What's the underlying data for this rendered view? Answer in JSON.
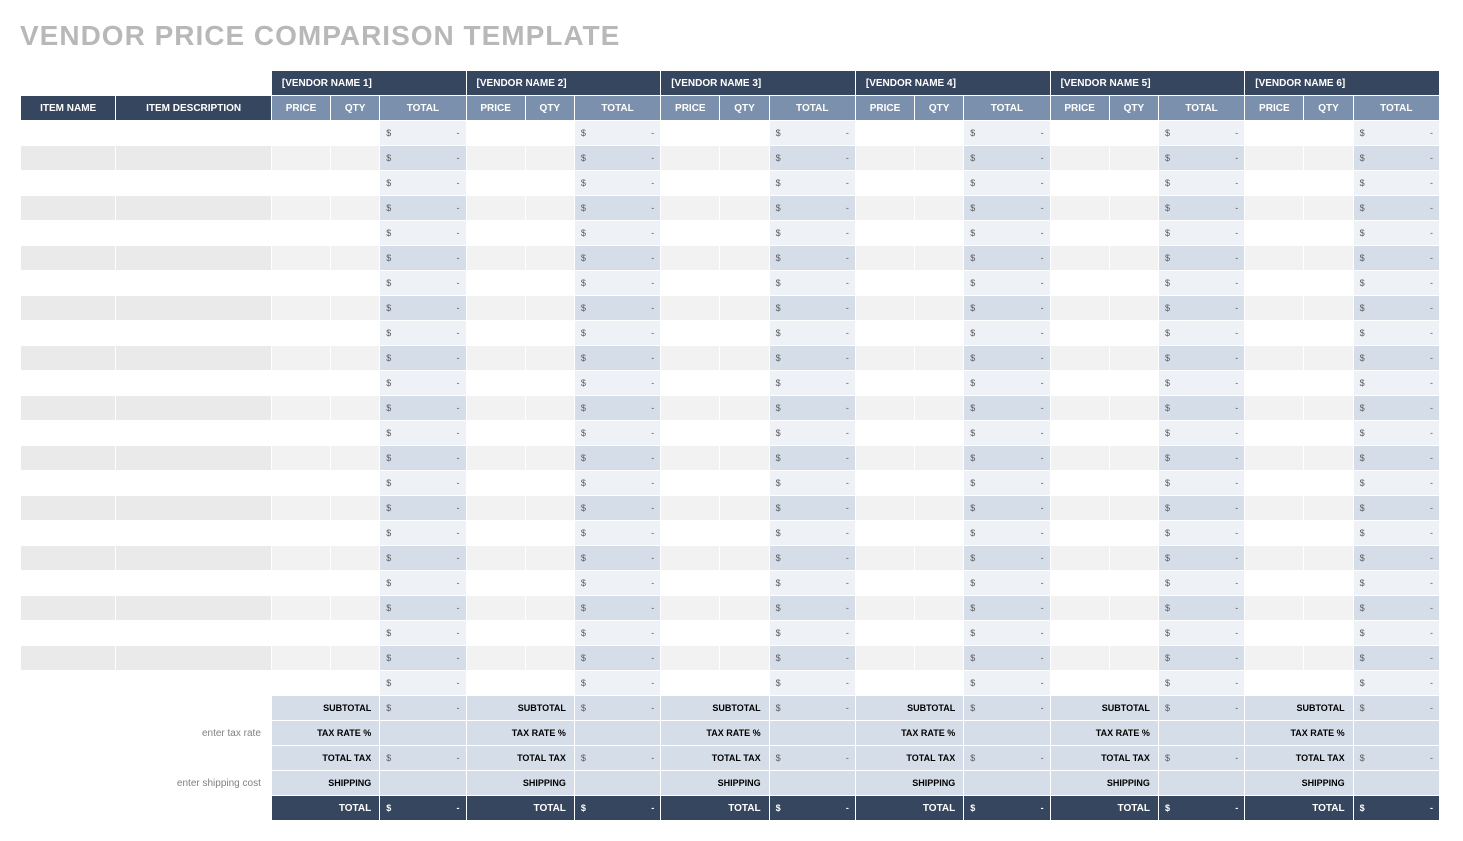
{
  "title": "VENDOR PRICE COMPARISON TEMPLATE",
  "columns": {
    "item_name": "ITEM NAME",
    "item_desc": "ITEM DESCRIPTION",
    "price": "PRICE",
    "qty": "QTY",
    "total": "TOTAL"
  },
  "vendors": [
    {
      "name": "[VENDOR NAME 1]"
    },
    {
      "name": "[VENDOR NAME 2]"
    },
    {
      "name": "[VENDOR NAME 3]"
    },
    {
      "name": "[VENDOR NAME 4]"
    },
    {
      "name": "[VENDOR NAME 5]"
    },
    {
      "name": "[VENDOR NAME 6]"
    }
  ],
  "row_count": 23,
  "currency_symbol": "$",
  "empty_value": "-",
  "summary": {
    "subtotal_label": "SUBTOTAL",
    "taxrate_label": "TAX RATE %",
    "totaltax_label": "TOTAL TAX",
    "shipping_label": "SHIPPING",
    "total_label": "TOTAL"
  },
  "hints": {
    "tax": "enter tax rate",
    "shipping": "enter shipping cost"
  }
}
